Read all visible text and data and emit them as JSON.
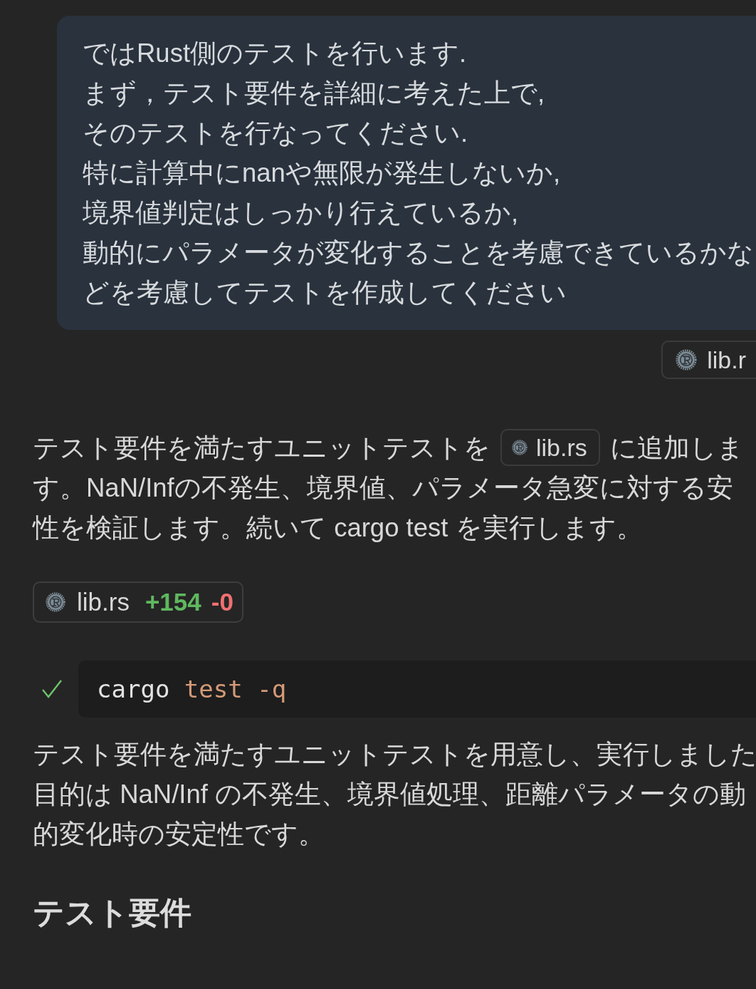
{
  "user_message": {
    "lines": [
      "ではRust側のテストを行います.",
      "まず，テスト要件を詳細に考えた上で,",
      "そのテストを行なってください.",
      "特に計算中にnanや無限が発生しないか,",
      "境界値判定はしっかり行えているか,",
      "動的にパラメータが変化することを考慮できているかな",
      "どを考慮してテストを作成してください"
    ],
    "attachments": [
      {
        "file": "lib.r"
      }
    ]
  },
  "response": [
    {
      "kind": "paragraph",
      "lines": [
        [
          {
            "kind": "text",
            "text": "テスト要件を満たすユニットテストを"
          },
          {
            "kind": "file",
            "text": "lib.rs"
          },
          {
            "kind": "text",
            "text": "に追加しま"
          }
        ],
        [
          {
            "kind": "text",
            "text": "す。NaN/Infの不発生、境界値、パラメータ急変に対する安"
          }
        ],
        [
          {
            "kind": "text",
            "text": "性を検証します。続いて cargo test を実行します。"
          }
        ]
      ]
    },
    {
      "kind": "file_diff",
      "file": "lib.rs",
      "added": "+154",
      "removed": "-0"
    },
    {
      "kind": "command",
      "succeeded": true,
      "tokens": [
        {
          "kind": "program",
          "text": "cargo"
        },
        {
          "kind": "argument",
          "text": "test"
        },
        {
          "kind": "argument",
          "text": "-q"
        }
      ]
    },
    {
      "kind": "paragraph",
      "lines": [
        [
          {
            "kind": "text",
            "text": "テスト要件を満たすユニットテストを用意し、実行しました"
          }
        ],
        [
          {
            "kind": "text",
            "text": "目的は NaN/Inf の不発生、境界値処理、距離パラメータの動"
          }
        ],
        [
          {
            "kind": "text",
            "text": "的変化時の安定性です。"
          }
        ]
      ]
    },
    {
      "kind": "heading",
      "text": "テスト要件"
    }
  ]
}
